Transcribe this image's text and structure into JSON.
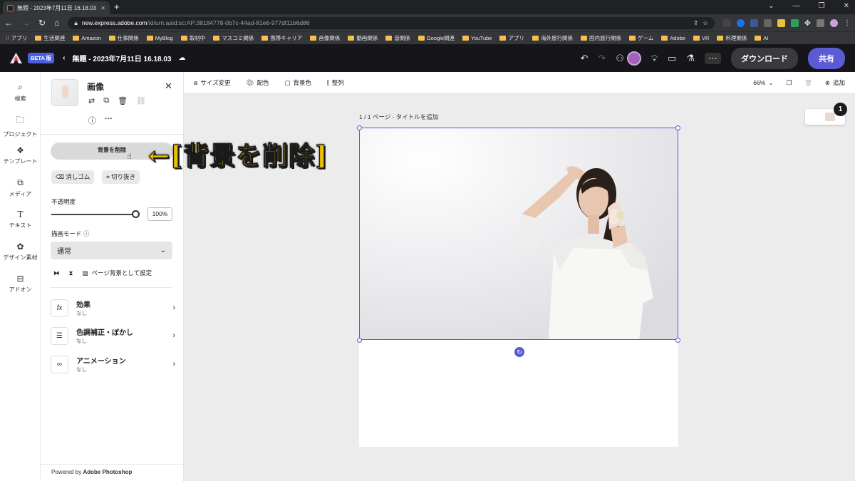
{
  "browser": {
    "tab_title": "無題 - 2023年7月11日 16.18.03",
    "url_host": "new.express.adobe.com",
    "url_path": "/id/urn:aaid:sc:AP:38184778-0b7c-44ad-81e6-977df11b6d86",
    "bookmarks": [
      "アプリ",
      "生活関連",
      "Amazon",
      "仕事関係",
      "MyBlog",
      "取材中",
      "マスコミ関係",
      "携帯キャリア",
      "画像関係",
      "動画関係",
      "音関係",
      "Google関連",
      "YouTube",
      "アプリ",
      "海外旅行関係",
      "国内旅行関係",
      "ゲーム",
      "Adobe",
      "VR",
      "料理関係",
      "AI"
    ]
  },
  "appbar": {
    "beta_label": "BETA 版",
    "doc_title": "無題 - 2023年7月11日 16.18.03",
    "download_label": "ダウンロード",
    "share_label": "共有"
  },
  "rail": [
    "検索",
    "プロジェクト",
    "テンプレート",
    "メディア",
    "テキスト",
    "デザイン素材",
    "アドオン"
  ],
  "panel": {
    "title": "画像",
    "remove_bg_label": "背景を削除",
    "eraser_label": "消しゴム",
    "crop_label": "切り抜き",
    "opacity_label": "不透明度",
    "opacity_value": "100%",
    "blend_label": "描画モード",
    "blend_value": "通常",
    "set_bg_label": "ページ背景として設定",
    "rows": [
      {
        "title": "効果",
        "sub": "なし"
      },
      {
        "title": "色調補正・ぼかし",
        "sub": "なし"
      },
      {
        "title": "アニメーション",
        "sub": "なし"
      }
    ],
    "powered_prefix": "Powered by",
    "powered_brand": "Adobe Photoshop"
  },
  "annotation": "←[背景を削除]",
  "canvas": {
    "tools": [
      "サイズ変更",
      "配色",
      "背景色",
      "整列"
    ],
    "zoom": "66%",
    "add_label": "追加",
    "page_label": "1 / 1 ページ - タイトルを追加",
    "page_count_badge": "1"
  },
  "colors": {
    "accent": "#5b5bd6",
    "annotation_text": "#f0c000",
    "appbar_bg": "#16161a"
  }
}
